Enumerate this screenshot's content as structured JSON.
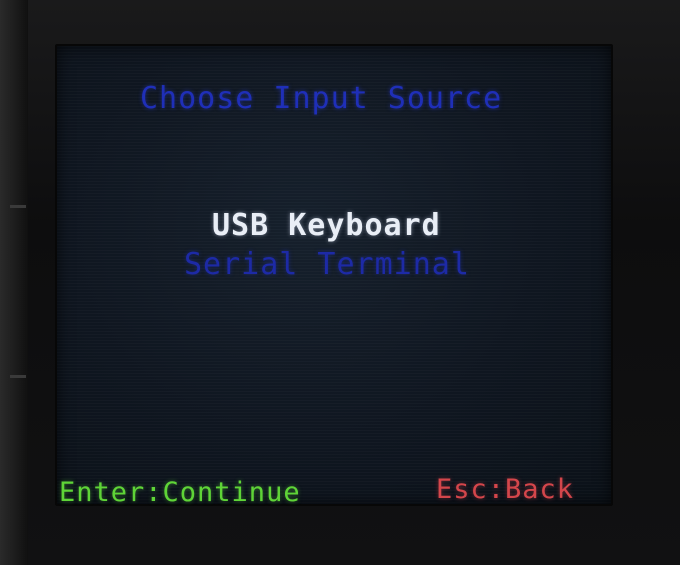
{
  "screen": {
    "title": "Choose Input Source",
    "options": [
      {
        "label": "USB Keyboard",
        "selected": true
      },
      {
        "label": "Serial Terminal",
        "selected": false
      }
    ],
    "footer": {
      "continue_hint": "Enter:Continue",
      "back_hint": "Esc:Back"
    }
  },
  "colors": {
    "title": "#1f2fb8",
    "selected_option": "#e9eef6",
    "unselected_option": "#1d2aa6",
    "continue_hint": "#5fd437",
    "back_hint": "#d4464b",
    "screen_background": "#0f1620"
  }
}
